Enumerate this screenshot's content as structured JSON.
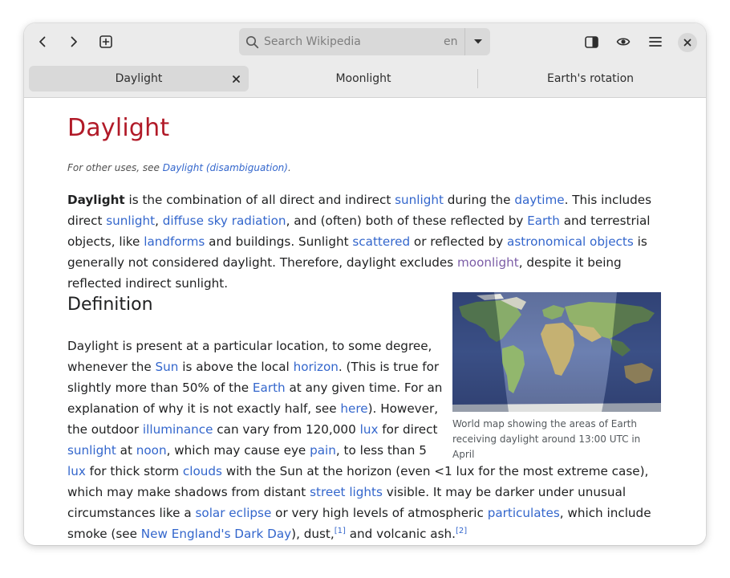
{
  "search": {
    "placeholder": "Search Wikipedia",
    "language": "en"
  },
  "tabs": [
    {
      "label": "Daylight",
      "active": true
    },
    {
      "label": "Moonlight",
      "active": false
    },
    {
      "label": "Earth's rotation",
      "active": false
    }
  ],
  "article": {
    "title": "Daylight",
    "hatnote": {
      "prefix": "For other uses, see ",
      "link": "Daylight (disambiguation)",
      "suffix": "."
    },
    "intro": [
      {
        "t": "Daylight",
        "b": true
      },
      {
        "t": " is the combination of all direct and indirect "
      },
      {
        "t": "sunlight",
        "link": true
      },
      {
        "t": " during the "
      },
      {
        "t": "daytime",
        "link": true
      },
      {
        "t": ". This includes direct "
      },
      {
        "t": "sunlight",
        "link": true
      },
      {
        "t": ", "
      },
      {
        "t": "diffuse sky radiation",
        "link": true
      },
      {
        "t": ", and (often) both of these reflected by "
      },
      {
        "t": "Earth",
        "link": true
      },
      {
        "t": " and terrestrial objects, like "
      },
      {
        "t": "landforms",
        "link": true
      },
      {
        "t": " and buildings. Sunlight "
      },
      {
        "t": "scattered",
        "link": true
      },
      {
        "t": " or reflected by "
      },
      {
        "t": "astronomical objects",
        "link": true
      },
      {
        "t": " is generally not considered daylight. Therefore, daylight excludes "
      },
      {
        "t": "moonlight",
        "visited": true
      },
      {
        "t": ", despite it being reflected indirect sunlight."
      }
    ],
    "section_heading": "Definition",
    "figure_caption": "World map showing the areas of Earth receiving daylight around 13:00 UTC in April",
    "definition": [
      {
        "t": "Daylight is present at a particular location, to some degree, whenever the "
      },
      {
        "t": "Sun",
        "link": true
      },
      {
        "t": " is above the local "
      },
      {
        "t": "horizon",
        "link": true
      },
      {
        "t": ". (This is true for slightly more than 50% of the "
      },
      {
        "t": "Earth",
        "link": true
      },
      {
        "t": " at any given time. For an explanation of why it is not exactly half, see "
      },
      {
        "t": "here",
        "link": true
      },
      {
        "t": "). However, the outdoor "
      },
      {
        "t": "illuminance",
        "link": true
      },
      {
        "t": " can vary from 120,000 "
      },
      {
        "t": "lux",
        "link": true
      },
      {
        "t": " for direct "
      },
      {
        "t": "sunlight",
        "link": true
      },
      {
        "t": " at "
      },
      {
        "t": "noon",
        "link": true
      },
      {
        "t": ", which may cause eye "
      },
      {
        "t": "pain",
        "link": true
      },
      {
        "t": ", to less than 5 "
      },
      {
        "t": "lux",
        "link": true
      },
      {
        "t": " for thick storm "
      },
      {
        "t": "clouds",
        "link": true
      },
      {
        "t": " with the Sun at the horizon (even <1 lux for the most extreme case), which may make shadows from distant "
      },
      {
        "t": "street lights",
        "link": true
      },
      {
        "t": " visible. It may be darker under unusual circumstances like a "
      },
      {
        "t": "solar eclipse",
        "link": true
      },
      {
        "t": " or very high levels of atmospheric "
      },
      {
        "t": "particulates",
        "link": true
      },
      {
        "t": ", which include smoke (see "
      },
      {
        "t": "New England's Dark Day",
        "link": true
      },
      {
        "t": "), dust,"
      },
      {
        "t": "[1]",
        "sup": true
      },
      {
        "t": " and volcanic ash."
      },
      {
        "t": "[2]",
        "sup": true
      }
    ]
  },
  "colors": {
    "title": "#b11a28",
    "link": "#3366cc",
    "visited_link": "#7b5ca6",
    "headerbar": "#ebebeb",
    "text": "#202122"
  },
  "icons": [
    "back-arrow-icon",
    "forward-arrow-icon",
    "new-tab-icon",
    "search-icon",
    "chevron-down-icon",
    "sidebar-icon",
    "eye-icon",
    "hamburger-menu-icon",
    "close-icon"
  ]
}
